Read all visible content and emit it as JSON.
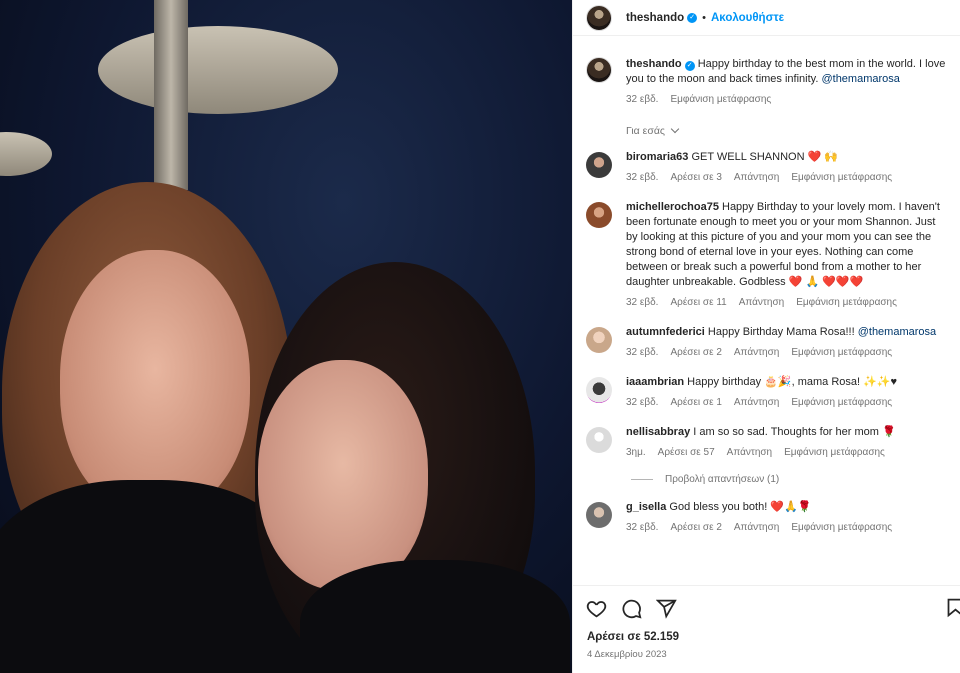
{
  "post": {
    "username": "theshando",
    "follow_label": "Ακολουθήστε",
    "caption_text": "Happy birthday to the best mom in the world. I love you to the moon and back times infinity.",
    "caption_mention": "@themamarosa",
    "caption_age": "32 εβδ.",
    "translation_label": "Εμφάνιση μετάφρασης",
    "for_you_label": "Για εσάς",
    "likes_label": "Αρέσει σε 52.159",
    "date": "4 Δεκεμβρίου 2023"
  },
  "comments": [
    {
      "user": "biromaria63",
      "text": "GET WELL SHANNON",
      "emoji": "❤️ 🙌",
      "age": "32 εβδ.",
      "likes": "Αρέσει σε 3",
      "reply": "Απάντηση",
      "translate": "Εμφάνιση μετάφρασης",
      "avatar_color": "#3b3b3b"
    },
    {
      "user": "michellerochoa75",
      "text": "Happy Birthday to your lovely mom. I haven't been fortunate enough to meet you or your mom Shannon. Just by looking at this picture of you and your mom you can see the strong bond of eternal love in your eyes. Nothing can come between or break such a powerful bond from a mother to her daughter unbreakable. Godbless",
      "emoji": "❤️ 🙏 ❤️❤️❤️",
      "age": "32 εβδ.",
      "likes": "Αρέσει σε 11",
      "reply": "Απάντηση",
      "translate": "Εμφάνιση μετάφρασης",
      "avatar_color": "#8a4b2b"
    },
    {
      "user": "autumnfederici",
      "text": "Happy Birthday Mama Rosa!!!",
      "mention": "@themamarosa",
      "age": "32 εβδ.",
      "likes": "Αρέσει σε 2",
      "reply": "Απάντηση",
      "translate": "Εμφάνιση μετάφρασης",
      "avatar_color": "#c9a78a"
    },
    {
      "user": "iaaambrian",
      "text": "Happy birthday",
      "emoji": "🎂🎉, mama Rosa! ✨✨♥",
      "age": "32 εβδ.",
      "likes": "Αρέσει σε 1",
      "reply": "Απάντηση",
      "translate": "Εμφάνιση μετάφρασης",
      "avatar_color": "#e7e7e7"
    },
    {
      "user": "nellisabbray",
      "text": "I am so so sad. Thoughts for her mom",
      "emoji": "🌹",
      "age": "3ημ.",
      "likes": "Αρέσει σε 57",
      "reply": "Απάντηση",
      "translate": "Εμφάνιση μετάφρασης",
      "avatar_color": "#dbdbdb"
    },
    {
      "user": "g_isella",
      "text": "God bless you both!",
      "emoji": "❤️🙏🌹",
      "age": "32 εβδ.",
      "likes": "Αρέσει σε 2",
      "reply": "Απάντηση",
      "translate": "Εμφάνιση μετάφρασης",
      "avatar_color": "#6d6d6d"
    }
  ],
  "view_replies_label": "Προβολή απαντήσεων (1)",
  "colors": {
    "link": "#00376b",
    "accent": "#0095f6",
    "muted": "#737373"
  },
  "icons": [
    "heart-icon",
    "comment-icon",
    "share-icon",
    "bookmark-icon",
    "verified-icon",
    "chevron-down-icon"
  ]
}
